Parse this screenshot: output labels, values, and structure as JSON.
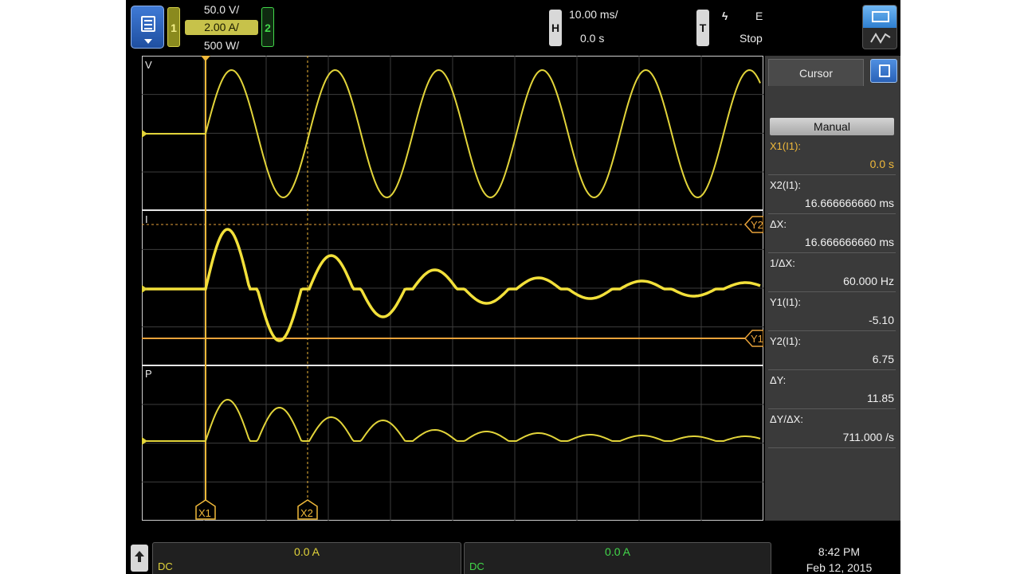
{
  "top_bar": {
    "channel1_badge": "1",
    "channel2_badge": "2",
    "scales": [
      "50.0 V/",
      "2.00 A/",
      "500 W/"
    ],
    "horizontal_badge": "H",
    "time_per_div": "10.00 ms/",
    "time_offset": "0.0 s",
    "trigger_badge": "T",
    "trigger_slope_glyph": "ϟ",
    "trigger_source": "E",
    "run_state": "Stop"
  },
  "waveform_labels": {
    "v": "V",
    "i": "I",
    "p": "P"
  },
  "markers": {
    "x1": "X1",
    "x2": "X2",
    "y1": "Y1",
    "y2": "Y2"
  },
  "cursor_panel": {
    "tab": "Cursor",
    "mode": "Manual",
    "rows": [
      {
        "label": "X1(I1):",
        "value": "0.0 s"
      },
      {
        "label": "X2(I1):",
        "value": "16.666666660 ms"
      },
      {
        "label": "ΔX:",
        "value": "16.666666660 ms"
      },
      {
        "label": "1/ΔX:",
        "value": "60.000 Hz"
      },
      {
        "label": "Y1(I1):",
        "value": "-5.10"
      },
      {
        "label": "Y2(I1):",
        "value": "6.75"
      },
      {
        "label": "ΔY:",
        "value": "11.85"
      },
      {
        "label": "ΔY/ΔX:",
        "value": "711.000 /s"
      }
    ]
  },
  "bottom_bar": {
    "field1": {
      "value": "0.0 A",
      "coupling": "DC"
    },
    "field2": {
      "value": "0.0 A",
      "coupling": "DC"
    },
    "time": "8:42 PM",
    "date": "Feb 12, 2015"
  },
  "colors": {
    "trace": "#e2d43a",
    "cursor_x": "#f0b93a",
    "cursor_y": "#e8a23a",
    "channel2": "#42d84a",
    "grid": "#3d3d3d"
  },
  "icons": [
    "menu-icon",
    "home-icon",
    "acquire-icon",
    "panel-menu-icon"
  ]
}
